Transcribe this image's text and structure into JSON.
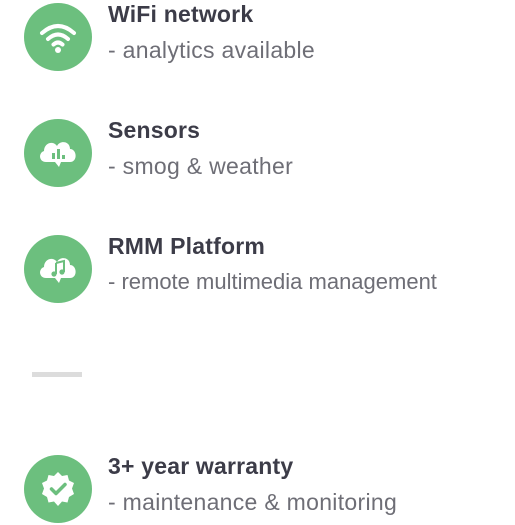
{
  "features": [
    {
      "title": "WiFi network",
      "description": "- analytics available",
      "icon": "wifi-icon"
    },
    {
      "title": "Sensors",
      "description": "- smog & weather",
      "icon": "cloud-chart-icon"
    },
    {
      "title": "RMM Platform",
      "description": "- remote multimedia management",
      "icon": "cloud-music-icon"
    },
    {
      "title": "3+ year warranty",
      "description": "- maintenance & monitoring",
      "icon": "badge-check-icon"
    }
  ],
  "colors": {
    "icon_background": "#6cbf7e",
    "title_text": "#3c3c48",
    "description_text": "#6e6e76",
    "divider": "#dcdcdc"
  }
}
